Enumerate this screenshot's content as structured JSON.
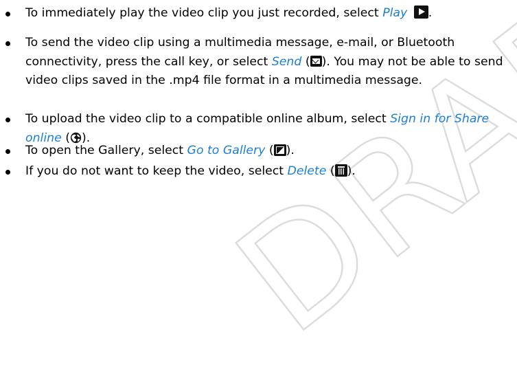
{
  "watermark": "DRAFT",
  "items": [
    {
      "text_before": "To immediately play the video clip you just recorded, select ",
      "link": "Play",
      "icon": "play-icon"
    },
    {
      "text_before": "To send the video clip using a multimedia message, e-mail, or Bluetooth connectivity, press the call key, or select ",
      "link": "Send",
      "icon": "message-envelope-icon",
      "text_after": "You may not be able to send video clips saved in the .mp4 file format in a multimedia message."
    },
    {
      "text_before": "To upload the video clip to a compatible online album, select ",
      "link": "Sign in for Share online",
      "icon": "share-online-globe-icon"
    },
    {
      "text_before": "To open the Gallery, select ",
      "link": "Go to Gallery",
      "icon": "gallery-icon"
    },
    {
      "text_before": "If you do not want to keep the video, select ",
      "link": "Delete",
      "icon": "trash-icon"
    }
  ],
  "colors": {
    "link": "#1a7fd6",
    "text": "#000000",
    "watermark_outline": "#c0c0c0"
  }
}
